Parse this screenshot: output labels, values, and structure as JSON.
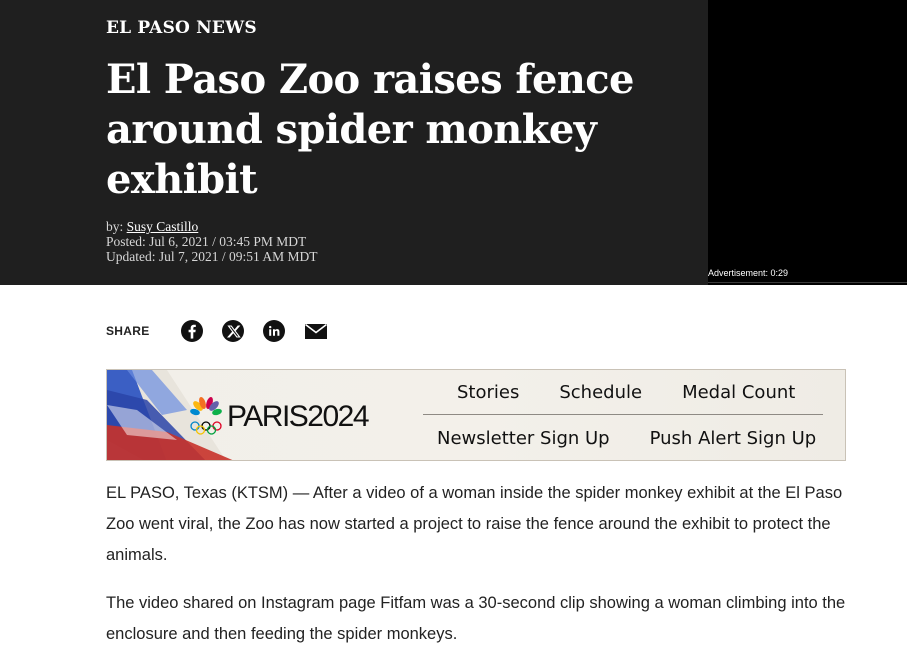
{
  "article": {
    "section": "EL PASO NEWS",
    "headline": "El Paso Zoo raises fence around spider monkey exhibit",
    "by_prefix": "by: ",
    "author": "Susy Castillo",
    "posted": "Posted: Jul 6, 2021 / 03:45 PM MDT",
    "updated": "Updated: Jul 7, 2021 / 09:51 AM MDT",
    "paragraphs": [
      "EL PASO, Texas (KTSM) — After a video of a woman inside the spider monkey exhibit at the El Paso Zoo went viral, the Zoo has now started a project to raise the fence around the exhibit to protect the animals.",
      "The video shared on Instagram page Fitfam was a 30-second clip showing a woman climbing into the enclosure and then feeding the spider monkeys."
    ]
  },
  "video": {
    "ad_label": "Advertisement: 0:29"
  },
  "share": {
    "label": "SHARE",
    "icons": [
      "facebook-icon",
      "x-icon",
      "linkedin-icon",
      "email-icon"
    ]
  },
  "banner": {
    "logo_text": "PARIS2024",
    "links_top": [
      "Stories",
      "Schedule",
      "Medal Count"
    ],
    "links_bottom": [
      "Newsletter Sign Up",
      "Push Alert Sign Up"
    ]
  },
  "colors": {
    "hero_bg": "#1f1f1f",
    "video_bg": "#000000",
    "text": "#222222"
  }
}
